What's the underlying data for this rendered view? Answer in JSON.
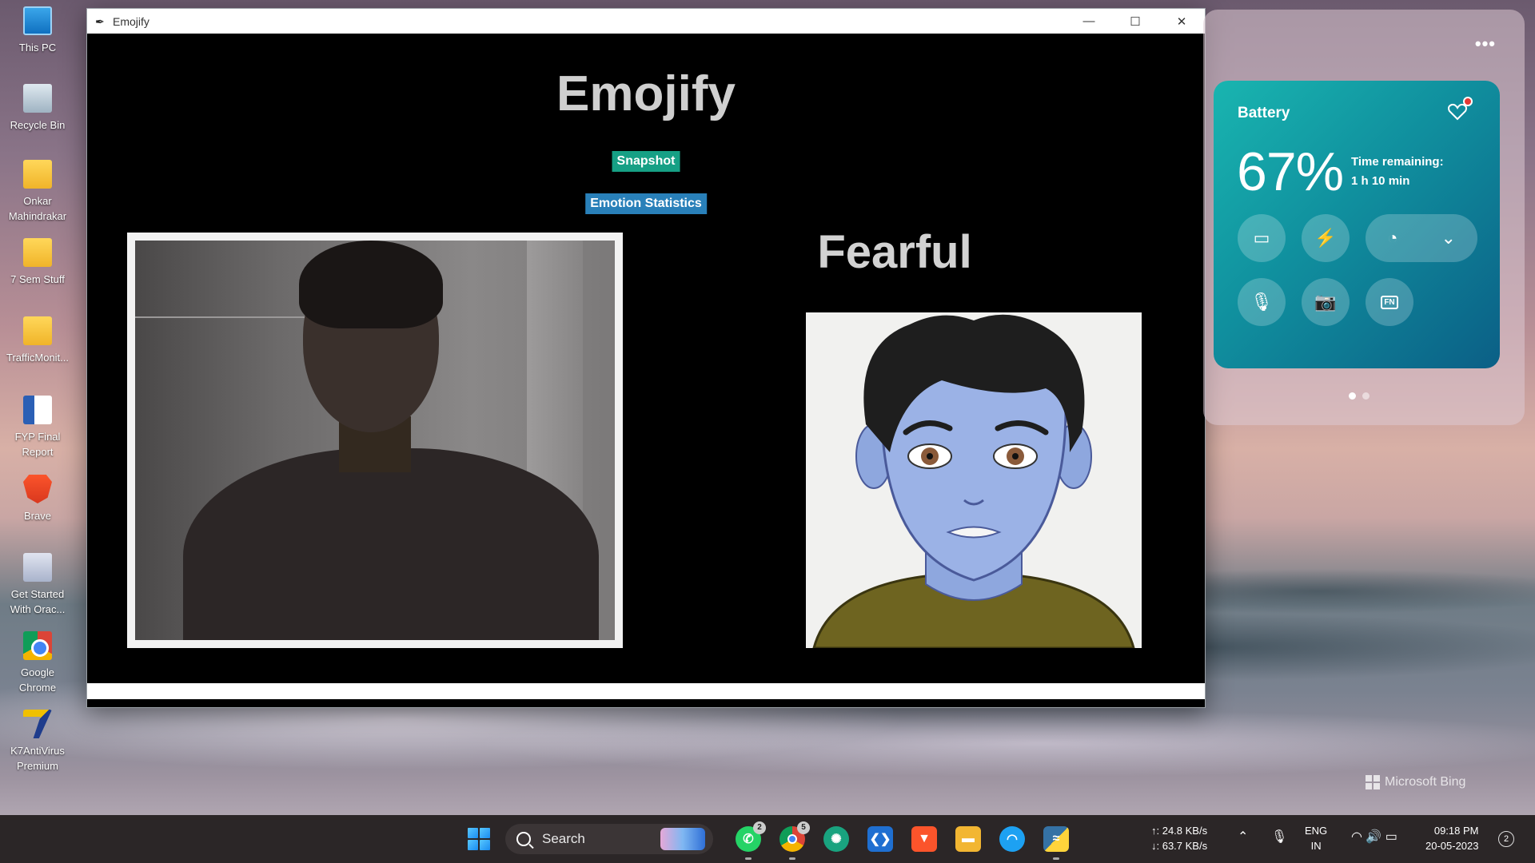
{
  "desktop": {
    "icons": [
      {
        "label": "This PC",
        "icon": "monitor-icon"
      },
      {
        "label": "Recycle Bin",
        "icon": "recycle-bin-icon"
      },
      {
        "label": "Onkar Mahindrakar",
        "icon": "folder-icon"
      },
      {
        "label": "7 Sem Stuff",
        "icon": "folder-icon"
      },
      {
        "label": "TrafficMonit...",
        "icon": "folder-icon"
      },
      {
        "label": "FYP Final Report",
        "icon": "word-document-icon"
      },
      {
        "label": "Brave",
        "icon": "brave-browser-icon"
      },
      {
        "label": "Get Started With Orac...",
        "icon": "oracle-database-icon"
      },
      {
        "label": "Google Chrome",
        "icon": "chrome-icon"
      },
      {
        "label": "K7AntiVirus Premium",
        "icon": "k7-antivirus-icon"
      }
    ],
    "watermark": "Microsoft Bing"
  },
  "window": {
    "title": "Emojify",
    "controls": {
      "minimize": "—",
      "maximize": "☐",
      "close": "✕"
    }
  },
  "app": {
    "heading": "Emojify",
    "snapshot_label": "Snapshot",
    "stats_label": "Emotion Statistics",
    "emotion": "Fearful",
    "colors": {
      "snapshot": "#16a085",
      "stats": "#2980b9",
      "background": "#000000"
    }
  },
  "quick_panel": {
    "more": "•••",
    "battery": {
      "title": "Battery",
      "percent": "67%",
      "time_label": "Time remaining:",
      "time_value": "1 h 10 min",
      "buttons": [
        "battery-saver-icon",
        "lightning-icon",
        "performance-icon",
        "chevron-down-icon",
        "microphone-icon",
        "camera-icon",
        "fn-lock-icon"
      ],
      "fn_label": "FN"
    },
    "page_count": 2,
    "active_page": 1
  },
  "taskbar": {
    "search_placeholder": "Search",
    "apps": [
      {
        "name": "whatsapp",
        "badge": "2"
      },
      {
        "name": "chrome",
        "badge": "5"
      },
      {
        "name": "chatgpt",
        "badge": ""
      },
      {
        "name": "vscode",
        "badge": ""
      },
      {
        "name": "brave",
        "badge": ""
      },
      {
        "name": "file-explorer",
        "badge": ""
      },
      {
        "name": "headphones",
        "badge": ""
      },
      {
        "name": "python",
        "badge": ""
      }
    ],
    "net_up": "↑: 24.8 KB/s",
    "net_down": "↓: 63.7 KB/s",
    "lang_top": "ENG",
    "lang_bottom": "IN",
    "time": "09:18 PM",
    "date": "20-05-2023",
    "notifications": "2"
  }
}
